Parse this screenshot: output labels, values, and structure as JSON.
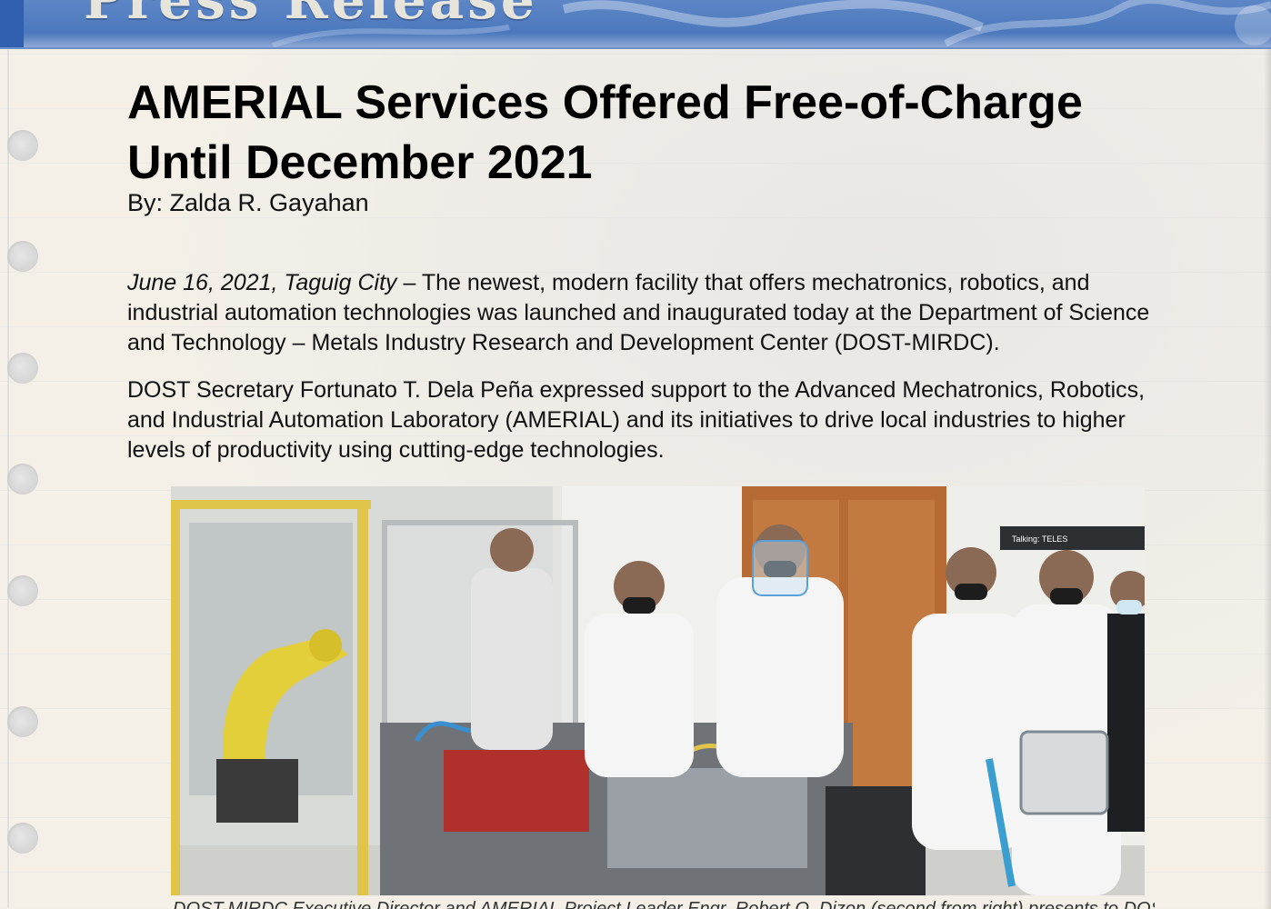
{
  "banner": {
    "title": "Press Release"
  },
  "article": {
    "title": "AMERIAL Services Offered Free-of-Charge Until December 2021",
    "byline": "By: Zalda R. Gayahan",
    "dateline": "June 16, 2021, Taguig City",
    "p1_rest": " – The newest, modern facility that offers mechatronics, robotics, and industrial automation technologies was launched and inaugurated today at the Department of Science and Technology – Metals Industry Research and Development Center (DOST-MIRDC).",
    "p2": "DOST Secretary Fortunato T. Dela Peña expressed support to the Advanced Mechatronics, Robotics, and Industrial Automation Laboratory (AMERIAL) and its initiatives to drive local industries to higher levels of productivity using cutting-edge technologies."
  },
  "photo": {
    "screen_label": "Talking: TELES",
    "caption": "DOST-MIRDC Executive Director and AMERIAL Project Leader Engr. Robert O. Dizon (second from right) presents to DOST"
  }
}
